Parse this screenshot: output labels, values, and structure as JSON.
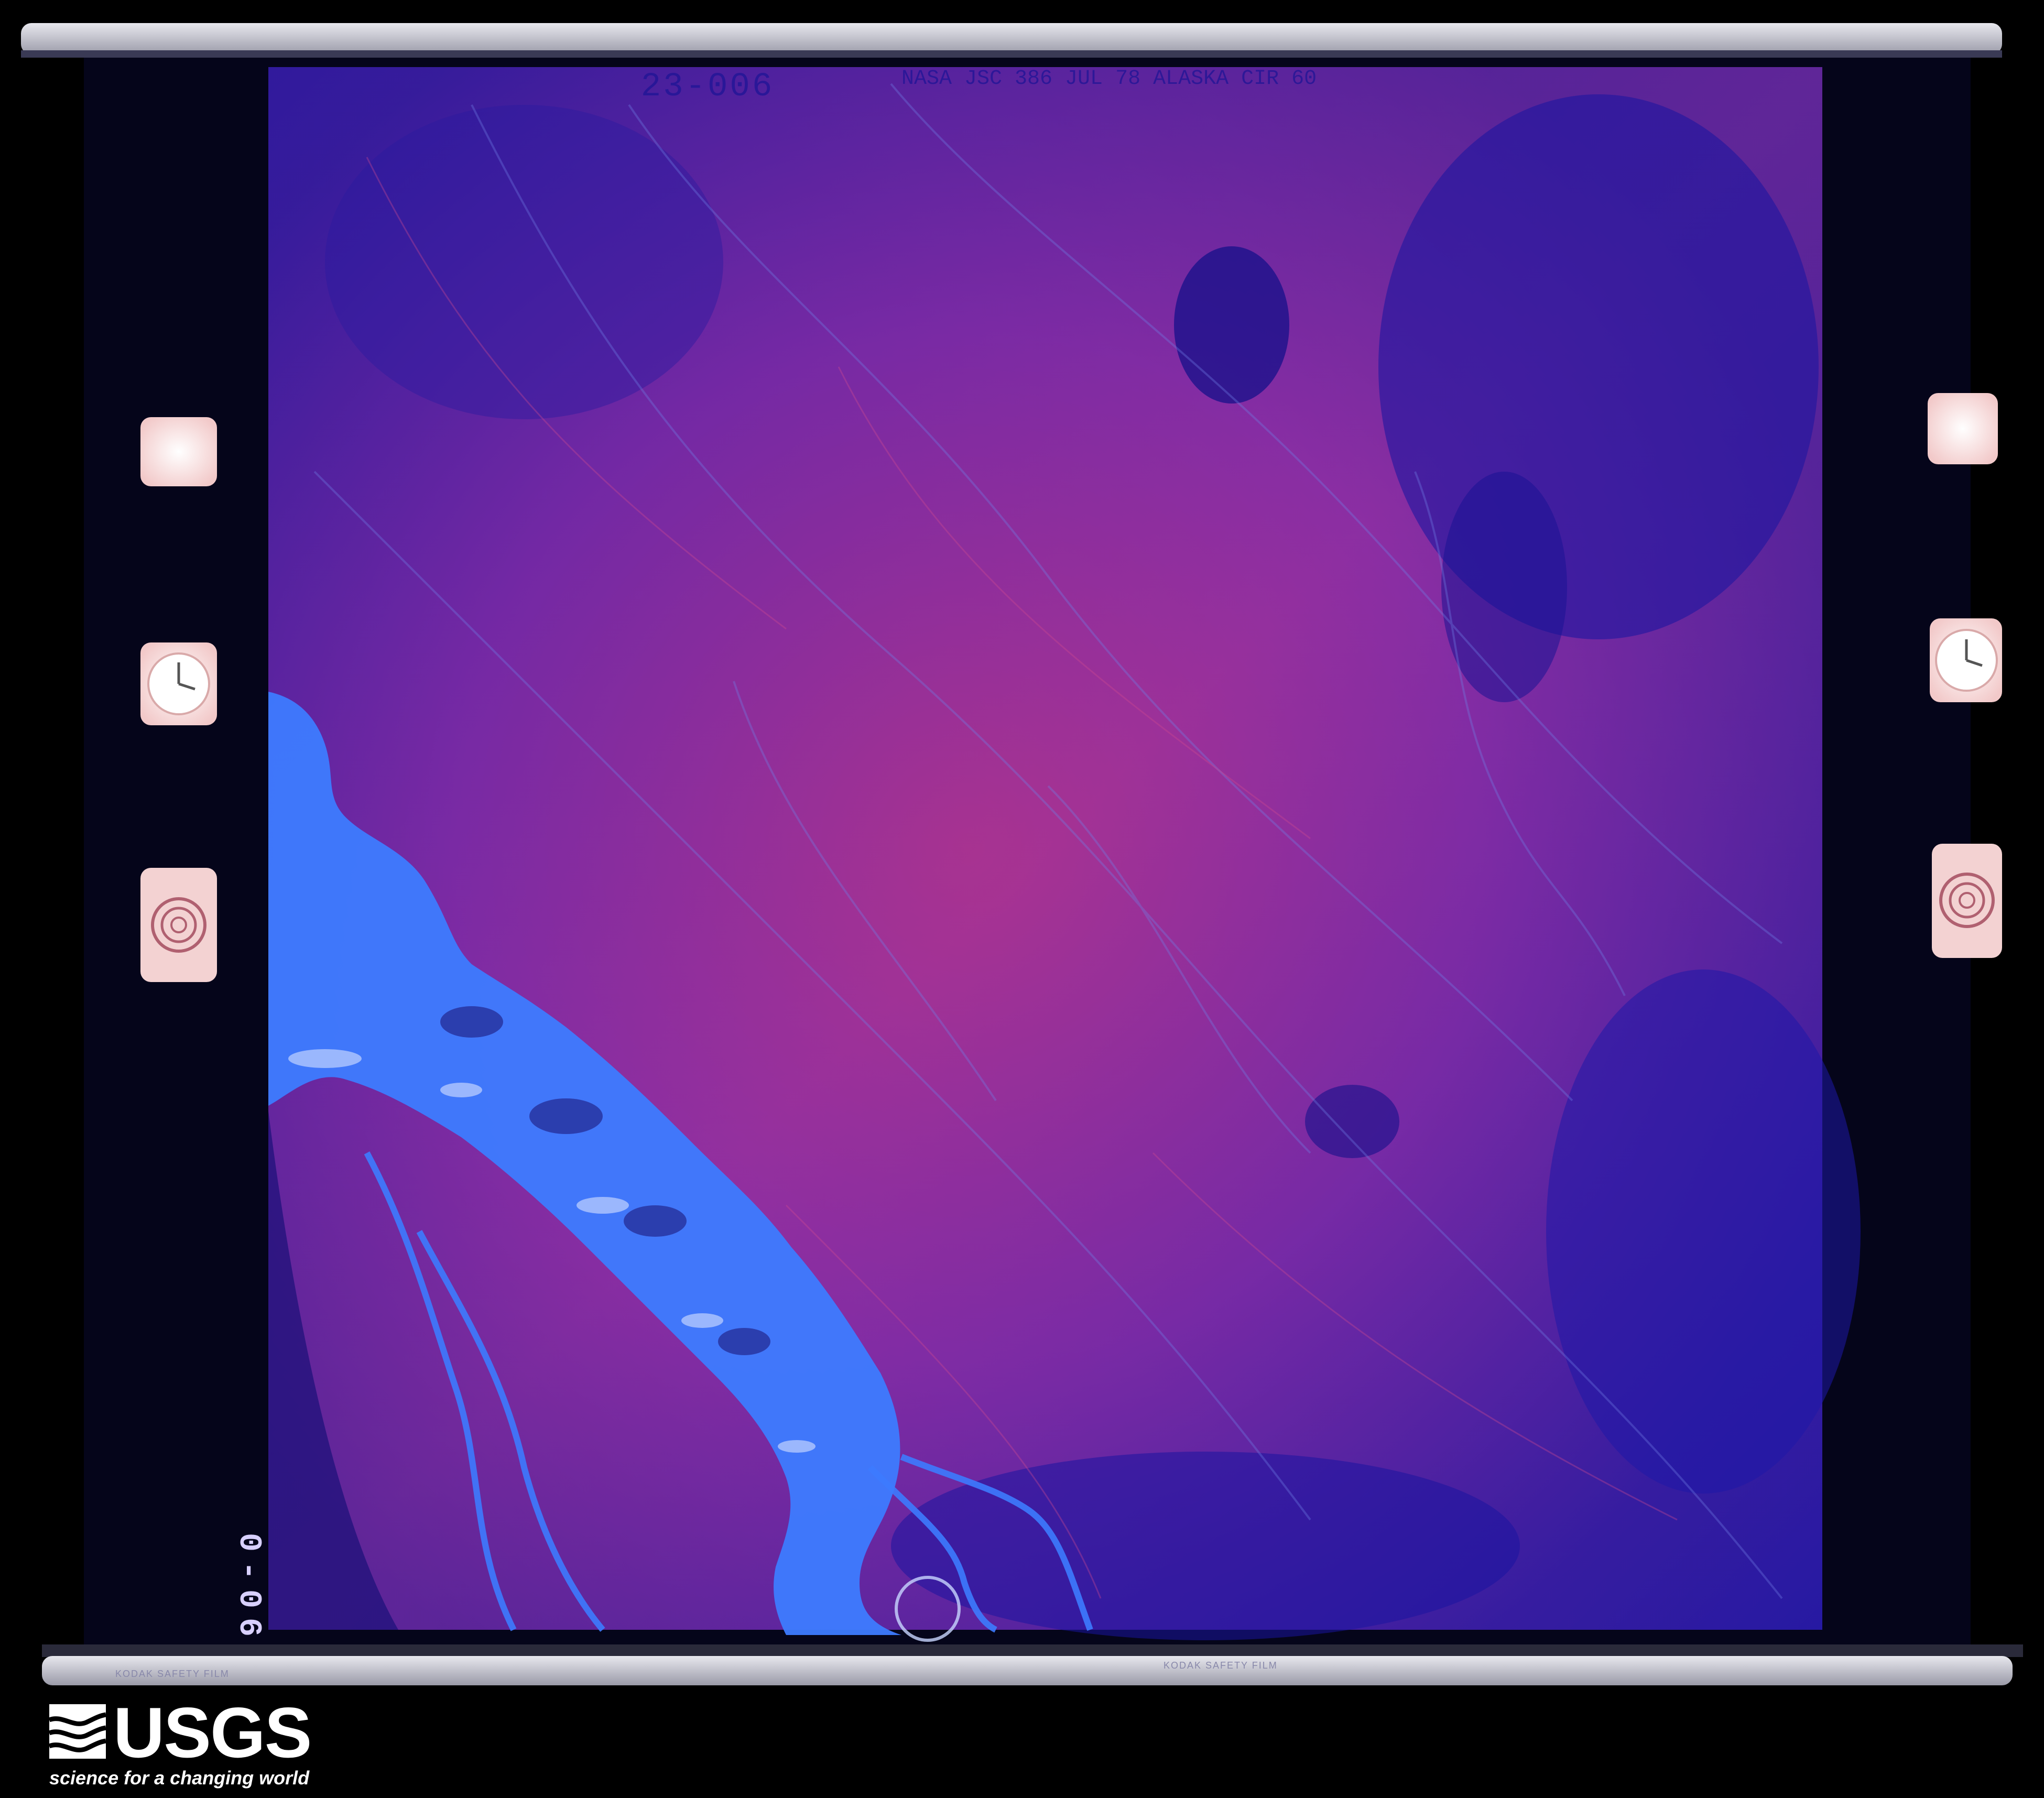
{
  "film_header": {
    "frame_number": "23-006",
    "annotation": "NASA JSC 386 JUL 78 ALASKA CIR 60"
  },
  "film_side": {
    "frame_number": "0-06"
  },
  "edge_print": {
    "left": "KODAK SAFETY FILM",
    "center": "KODAK SAFETY FILM"
  },
  "logo": {
    "name": "USGS",
    "tagline": "science for a changing world"
  },
  "colors": {
    "water": "#3d7bff",
    "vegetation": "#b02a8a",
    "terrain": "#3a1f9a",
    "film_base": "#05051a"
  }
}
